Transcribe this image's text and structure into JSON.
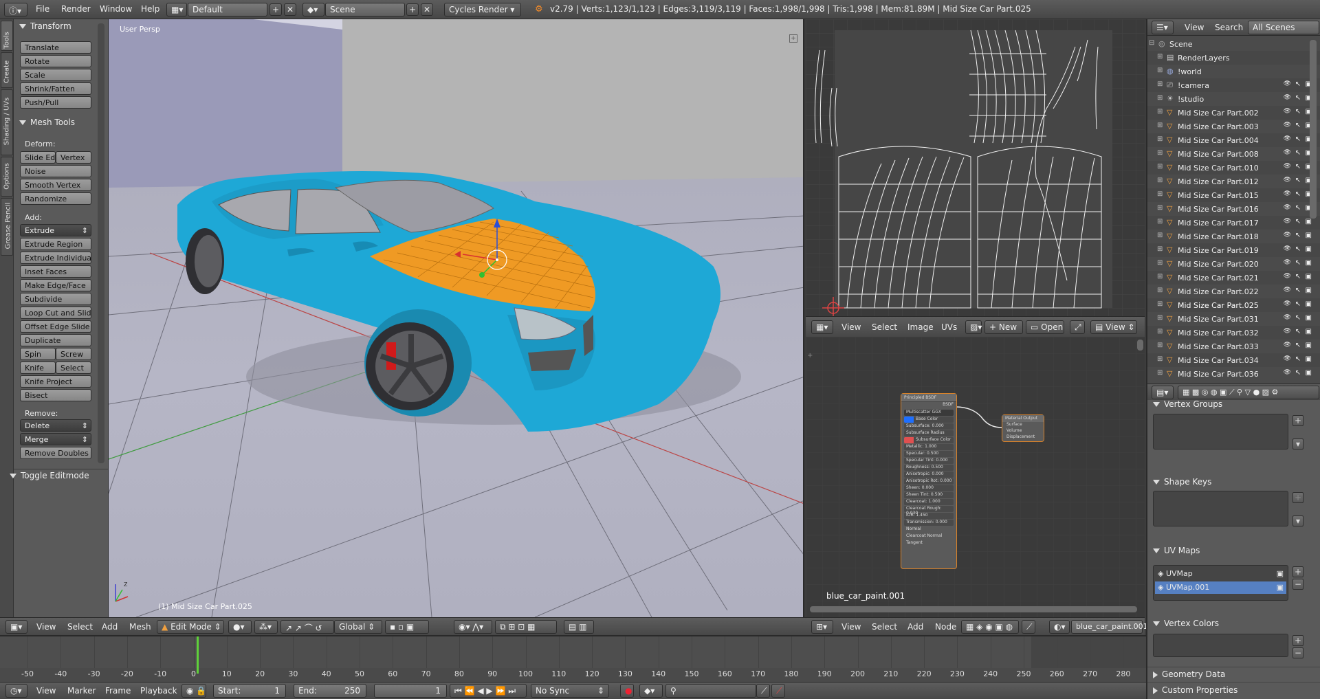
{
  "topbar": {
    "menus": [
      "File",
      "Render",
      "Window",
      "Help"
    ],
    "layout": "Default",
    "scene": "Scene",
    "engine": "Cycles Render",
    "stats": "v2.79 | Verts:1,123/1,123 | Edges:3,119/3,119 | Faces:1,998/1,998 | Tris:1,998 | Mem:81.89M | Mid Size Car Part.025"
  },
  "shelf": {
    "tabs": [
      "Tools",
      "Create",
      "Shading / UVs",
      "Options",
      "Grease Pencil"
    ],
    "transform_title": "Transform",
    "transform": [
      "Translate",
      "Rotate",
      "Scale",
      "Shrink/Fatten",
      "Push/Pull"
    ],
    "mesh_title": "Mesh Tools",
    "deform_label": "Deform:",
    "deform_row": [
      "Slide Ed",
      "Vertex"
    ],
    "deform": [
      "Noise",
      "Smooth Vertex",
      "Randomize"
    ],
    "add_label": "Add:",
    "extrude": "Extrude",
    "add": [
      "Extrude Region",
      "Extrude Individual",
      "Inset Faces",
      "Make Edge/Face",
      "Subdivide",
      "Loop Cut and Slide",
      "Offset Edge Slide",
      "Duplicate"
    ],
    "spin_row": [
      "Spin",
      "Screw"
    ],
    "knife_row": [
      "Knife",
      "Select"
    ],
    "add2": [
      "Knife Project",
      "Bisect"
    ],
    "remove_label": "Remove:",
    "delete": "Delete",
    "merge": "Merge",
    "remove_doubles": "Remove Doubles",
    "toggle_title": "Toggle Editmode"
  },
  "viewport": {
    "label": "User Persp",
    "object_label": "(1) Mid Size Car Part.025",
    "header": {
      "menus": [
        "View",
        "Select",
        "Add",
        "Mesh"
      ],
      "mode": "Edit Mode",
      "orientation": "Global"
    }
  },
  "uv_header": {
    "menus": [
      "View",
      "Select",
      "Image",
      "UVs"
    ],
    "new": "New",
    "open": "Open",
    "view": "View"
  },
  "node_editor": {
    "material_label": "blue_car_paint.001",
    "header": {
      "menus": [
        "View",
        "Select",
        "Add",
        "Node"
      ],
      "material": "blue_car_paint.001"
    },
    "bsdf": {
      "title": "Principled BSDF",
      "out": "BSDF",
      "dist": "Multiscatter GGX",
      "rows": [
        "Base Color",
        "Subsurface: 0.000",
        "Subsurface Radius",
        "Subsurface Color",
        "Metallic: 1.000",
        "Specular: 0.500",
        "Specular Tint: 0.000",
        "Roughness: 0.500",
        "Anisotropic: 0.000",
        "Anisotropic Rot: 0.000",
        "Sheen: 0.000",
        "Sheen Tint: 0.500",
        "Clearcoat: 1.000",
        "Clearcoat Rough: 0.030",
        "IOR: 1.450",
        "Transmission: 0.000",
        "Normal",
        "Clearcoat Normal",
        "Tangent"
      ]
    },
    "output": {
      "title": "Material Output",
      "rows": [
        "Surface",
        "Volume",
        "Displacement"
      ]
    },
    "colors": {
      "base": "#1e6fff",
      "subsurface": "#e05050"
    }
  },
  "outliner": {
    "menus": [
      "View",
      "Search"
    ],
    "filter": "All Scenes",
    "rows": [
      "Scene",
      "RenderLayers",
      "!world",
      "!camera",
      "!studio",
      "Mid Size Car Part.002",
      "Mid Size Car Part.003",
      "Mid Size Car Part.004",
      "Mid Size Car Part.008",
      "Mid Size Car Part.010",
      "Mid Size Car Part.012",
      "Mid Size Car Part.015",
      "Mid Size Car Part.016",
      "Mid Size Car Part.017",
      "Mid Size Car Part.018",
      "Mid Size Car Part.019",
      "Mid Size Car Part.020",
      "Mid Size Car Part.021",
      "Mid Size Car Part.022",
      "Mid Size Car Part.025",
      "Mid Size Car Part.031",
      "Mid Size Car Part.032",
      "Mid Size Car Part.033",
      "Mid Size Car Part.034",
      "Mid Size Car Part.036"
    ]
  },
  "properties": {
    "vertex_groups": "Vertex Groups",
    "shape_keys": "Shape Keys",
    "uv_maps": "UV Maps",
    "uv_list": [
      "UVMap",
      "UVMap.001"
    ],
    "vertex_colors": "Vertex Colors",
    "geometry_data": "Geometry Data",
    "custom_properties": "Custom Properties"
  },
  "timeline": {
    "ticks": [
      "-50",
      "-40",
      "-30",
      "-20",
      "-10",
      "0",
      "10",
      "20",
      "30",
      "40",
      "50",
      "60",
      "70",
      "80",
      "90",
      "100",
      "110",
      "120",
      "130",
      "140",
      "150",
      "160",
      "170",
      "180",
      "190",
      "200",
      "210",
      "220",
      "230",
      "240",
      "250",
      "260",
      "270",
      "280"
    ],
    "footer": {
      "menus": [
        "View",
        "Marker",
        "Frame",
        "Playback"
      ],
      "start": "Start:",
      "start_val": "1",
      "end": "End:",
      "end_val": "250",
      "current": "1",
      "sync": "No Sync"
    }
  }
}
